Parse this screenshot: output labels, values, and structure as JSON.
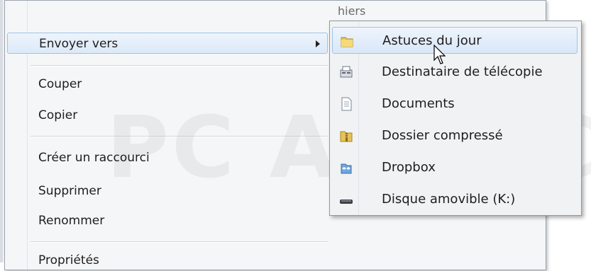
{
  "background": {
    "hint_text": "hiers"
  },
  "context_menu": {
    "items": [
      {
        "label": "Envoyer vers",
        "has_submenu": true
      },
      {
        "label": "Couper"
      },
      {
        "label": "Copier"
      },
      {
        "label": "Créer un raccourci"
      },
      {
        "label": "Supprimer"
      },
      {
        "label": "Renommer"
      },
      {
        "label": "Propriétés"
      }
    ]
  },
  "submenu": {
    "items": [
      {
        "label": "Astuces du jour",
        "icon": "folder-icon"
      },
      {
        "label": "Destinataire de télécopie",
        "icon": "fax-icon"
      },
      {
        "label": "Documents",
        "icon": "documents-icon"
      },
      {
        "label": "Dossier compressé",
        "icon": "zip-folder-icon"
      },
      {
        "label": "Dropbox",
        "icon": "dropbox-icon"
      },
      {
        "label": "Disque amovible (K:)",
        "icon": "removable-drive-icon"
      }
    ]
  },
  "watermark": {
    "text": "PC ASTUCES"
  },
  "colors": {
    "highlight_border": "#9ec2eb",
    "highlight_fill": "#dce9f8",
    "menu_bg": "#f5f6f7"
  }
}
